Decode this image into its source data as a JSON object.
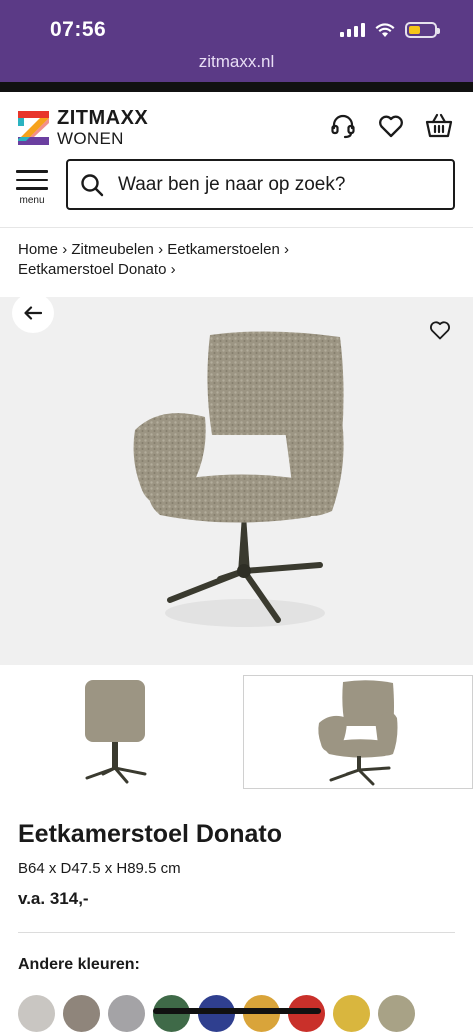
{
  "status_bar": {
    "time": "07:56",
    "battery_level": 0.45
  },
  "browser": {
    "url": "zitmaxx.nl"
  },
  "header": {
    "brand": "ZITMAXX",
    "brand_sub": "WONEN",
    "menu_label": "menu",
    "search_placeholder": "Waar ben je naar op zoek?",
    "icons": [
      "headset-icon",
      "heart-icon",
      "basket-icon"
    ]
  },
  "breadcrumb": {
    "items": [
      "Home",
      "Zitmeubelen",
      "Eetkamerstoelen",
      "Eetkamerstoel Donato"
    ],
    "separator": "›"
  },
  "product": {
    "title": "Eetkamerstoel Donato",
    "dimensions": "B64 x D47.5 x H89.5 cm",
    "price_prefix": "v.a.",
    "price": "314,-"
  },
  "other_colors": {
    "title": "Andere kleuren:",
    "swatches": [
      "#c9c6c2",
      "#8f857b",
      "#a4a3a6",
      "#3f6a48",
      "#2f3f8f",
      "#d9a43a",
      "#c9302a",
      "#d9b63e",
      "#a8a286"
    ]
  },
  "colors": {
    "brand_purple": "#5b3a86",
    "chair_fabric": "#9c9583",
    "chair_metal": "#3a3a2f"
  }
}
